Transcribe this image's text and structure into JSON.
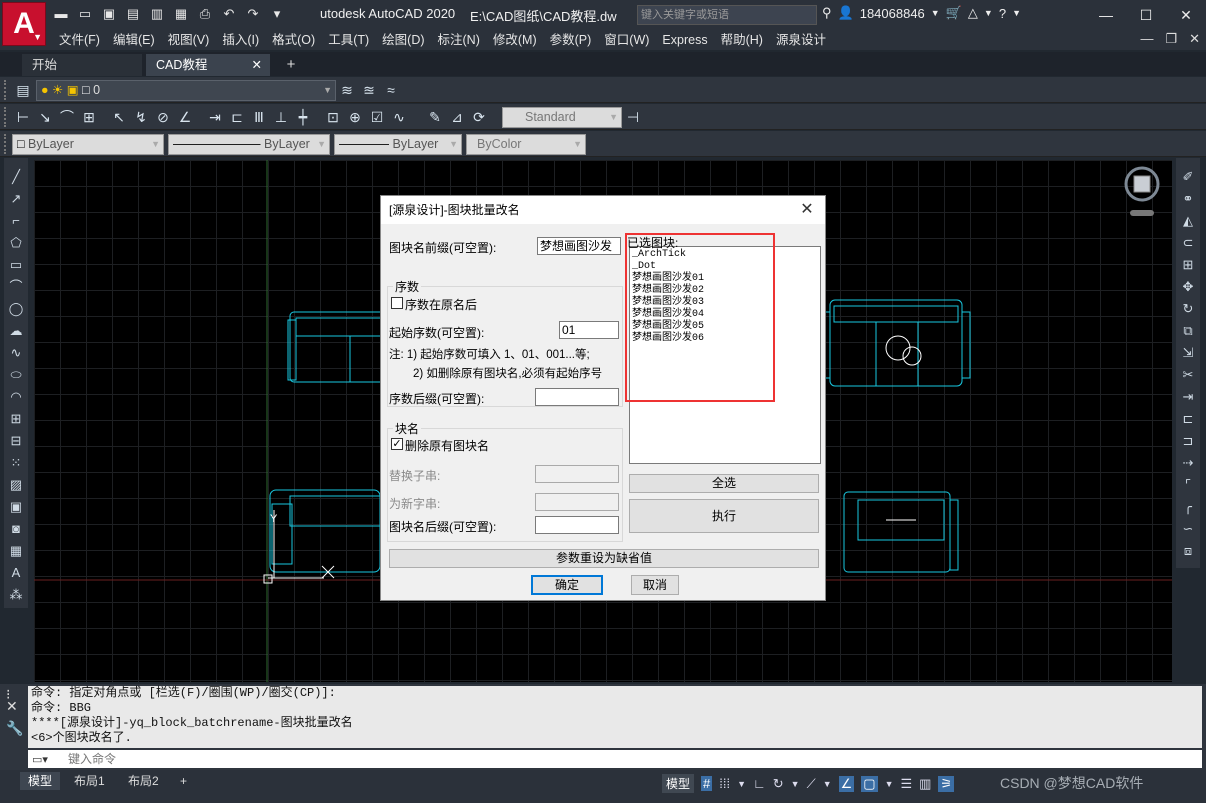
{
  "titlebar": {
    "app_logo": "A",
    "app_title": "utodesk AutoCAD 2020",
    "file_path": "E:\\CAD图纸\\CAD教程.dw",
    "search_placeholder": "键入关键字或短语",
    "user_id": "184068846"
  },
  "menu": [
    "文件(F)",
    "编辑(E)",
    "视图(V)",
    "插入(I)",
    "格式(O)",
    "工具(T)",
    "绘图(D)",
    "标注(N)",
    "修改(M)",
    "参数(P)",
    "窗口(W)",
    "Express",
    "帮助(H)",
    "源泉设计"
  ],
  "tabs": {
    "start": "开始",
    "active": "CAD教程"
  },
  "layer_toolbar": {
    "layer_value": "0"
  },
  "dim_toolbar": {
    "style_value": "Standard"
  },
  "props_toolbar": {
    "color": "ByLayer",
    "linetype": "ByLayer",
    "lineweight": "ByLayer",
    "plotstyle": "ByColor"
  },
  "dialog": {
    "title": "[源泉设计]-图块批量改名",
    "prefix_label": "图块名前缀(可空置):",
    "prefix_value": "梦想画图沙发",
    "seq_group": "序数",
    "seq_after_name": "序数在原名后",
    "start_seq_label": "起始序数(可空置):",
    "start_seq_value": "01",
    "note1": "注: 1) 起始序数可填入 1、01、001...等;",
    "note2": "2) 如删除原有图块名,必须有起始序号",
    "seq_suffix_label": "序数后缀(可空置):",
    "name_group": "块名",
    "delete_original": "删除原有图块名",
    "replace_sub": "替换子串:",
    "new_sub": "为新字串:",
    "name_suffix_label": "图块名后缀(可空置):",
    "list_header": "已选图块:",
    "list_items": [
      "_ArchTick",
      "_Dot",
      "梦想画图沙发01",
      "梦想画图沙发02",
      "梦想画图沙发03",
      "梦想画图沙发04",
      "梦想画图沙发05",
      "梦想画图沙发06"
    ],
    "select_all": "全选",
    "execute": "执行",
    "reset": "参数重设为缺省值",
    "ok": "确定",
    "cancel": "取消"
  },
  "command_history": [
    "命令: 指定对角点或 [栏选(F)/圈围(WP)/圈交(CP)]:",
    "命令: BBG",
    "****[源泉设计]-yq_block_batchrename-图块批量改名",
    "<6>个图块改名了."
  ],
  "command_placeholder": "键入命令",
  "layout_tabs": [
    "模型",
    "布局1",
    "布局2"
  ],
  "status": {
    "model_label": "模型"
  },
  "watermark": "CSDN @梦想CAD软件"
}
